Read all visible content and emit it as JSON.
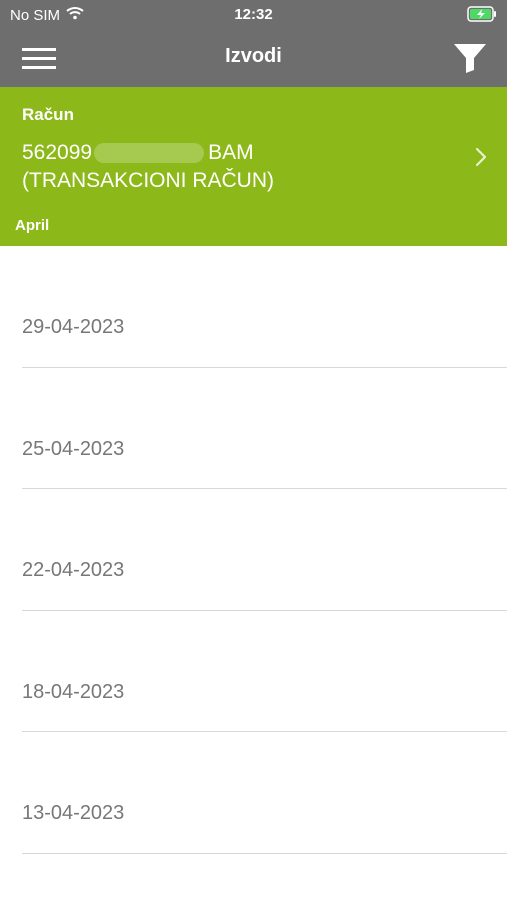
{
  "status_bar": {
    "carrier": "No SIM",
    "time": "12:32",
    "battery_icon": "battery-charging-icon",
    "wifi_icon": "wifi-icon"
  },
  "header": {
    "title": "Izvodi",
    "menu_icon": "hamburger-menu-icon",
    "filter_icon": "filter-icon",
    "background_color": "#6e6e6e"
  },
  "account": {
    "label": "Račun",
    "number_prefix": "562099",
    "currency": "BAM",
    "name": "(TRANSAKCIONI RAČUN)",
    "month": "April",
    "background_color": "#8cb81a"
  },
  "statements": [
    {
      "date": "29-04-2023"
    },
    {
      "date": "25-04-2023"
    },
    {
      "date": "22-04-2023"
    },
    {
      "date": "18-04-2023"
    },
    {
      "date": "13-04-2023"
    }
  ]
}
